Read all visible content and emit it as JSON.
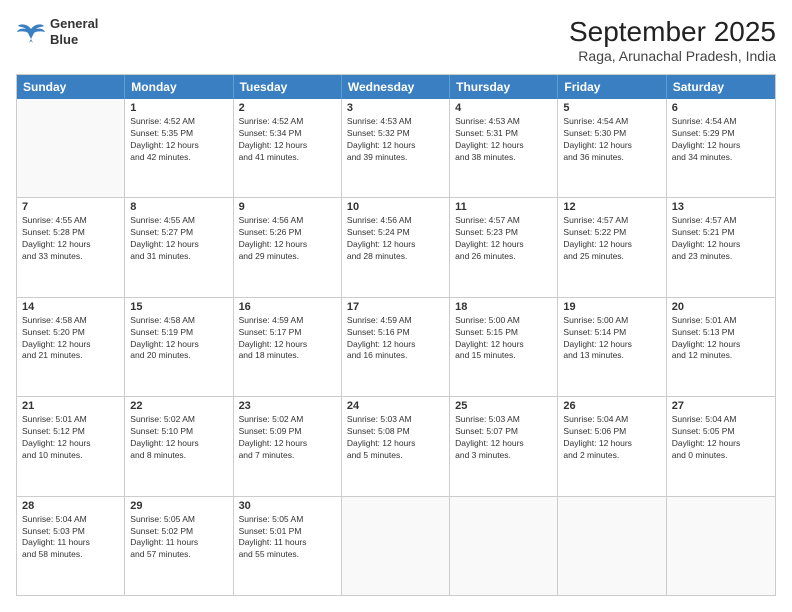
{
  "logo": {
    "line1": "General",
    "line2": "Blue"
  },
  "title": "September 2025",
  "location": "Raga, Arunachal Pradesh, India",
  "days_header": [
    "Sunday",
    "Monday",
    "Tuesday",
    "Wednesday",
    "Thursday",
    "Friday",
    "Saturday"
  ],
  "weeks": [
    [
      {
        "day": "",
        "info": ""
      },
      {
        "day": "1",
        "info": "Sunrise: 4:52 AM\nSunset: 5:35 PM\nDaylight: 12 hours\nand 42 minutes."
      },
      {
        "day": "2",
        "info": "Sunrise: 4:52 AM\nSunset: 5:34 PM\nDaylight: 12 hours\nand 41 minutes."
      },
      {
        "day": "3",
        "info": "Sunrise: 4:53 AM\nSunset: 5:32 PM\nDaylight: 12 hours\nand 39 minutes."
      },
      {
        "day": "4",
        "info": "Sunrise: 4:53 AM\nSunset: 5:31 PM\nDaylight: 12 hours\nand 38 minutes."
      },
      {
        "day": "5",
        "info": "Sunrise: 4:54 AM\nSunset: 5:30 PM\nDaylight: 12 hours\nand 36 minutes."
      },
      {
        "day": "6",
        "info": "Sunrise: 4:54 AM\nSunset: 5:29 PM\nDaylight: 12 hours\nand 34 minutes."
      }
    ],
    [
      {
        "day": "7",
        "info": "Sunrise: 4:55 AM\nSunset: 5:28 PM\nDaylight: 12 hours\nand 33 minutes."
      },
      {
        "day": "8",
        "info": "Sunrise: 4:55 AM\nSunset: 5:27 PM\nDaylight: 12 hours\nand 31 minutes."
      },
      {
        "day": "9",
        "info": "Sunrise: 4:56 AM\nSunset: 5:26 PM\nDaylight: 12 hours\nand 29 minutes."
      },
      {
        "day": "10",
        "info": "Sunrise: 4:56 AM\nSunset: 5:24 PM\nDaylight: 12 hours\nand 28 minutes."
      },
      {
        "day": "11",
        "info": "Sunrise: 4:57 AM\nSunset: 5:23 PM\nDaylight: 12 hours\nand 26 minutes."
      },
      {
        "day": "12",
        "info": "Sunrise: 4:57 AM\nSunset: 5:22 PM\nDaylight: 12 hours\nand 25 minutes."
      },
      {
        "day": "13",
        "info": "Sunrise: 4:57 AM\nSunset: 5:21 PM\nDaylight: 12 hours\nand 23 minutes."
      }
    ],
    [
      {
        "day": "14",
        "info": "Sunrise: 4:58 AM\nSunset: 5:20 PM\nDaylight: 12 hours\nand 21 minutes."
      },
      {
        "day": "15",
        "info": "Sunrise: 4:58 AM\nSunset: 5:19 PM\nDaylight: 12 hours\nand 20 minutes."
      },
      {
        "day": "16",
        "info": "Sunrise: 4:59 AM\nSunset: 5:17 PM\nDaylight: 12 hours\nand 18 minutes."
      },
      {
        "day": "17",
        "info": "Sunrise: 4:59 AM\nSunset: 5:16 PM\nDaylight: 12 hours\nand 16 minutes."
      },
      {
        "day": "18",
        "info": "Sunrise: 5:00 AM\nSunset: 5:15 PM\nDaylight: 12 hours\nand 15 minutes."
      },
      {
        "day": "19",
        "info": "Sunrise: 5:00 AM\nSunset: 5:14 PM\nDaylight: 12 hours\nand 13 minutes."
      },
      {
        "day": "20",
        "info": "Sunrise: 5:01 AM\nSunset: 5:13 PM\nDaylight: 12 hours\nand 12 minutes."
      }
    ],
    [
      {
        "day": "21",
        "info": "Sunrise: 5:01 AM\nSunset: 5:12 PM\nDaylight: 12 hours\nand 10 minutes."
      },
      {
        "day": "22",
        "info": "Sunrise: 5:02 AM\nSunset: 5:10 PM\nDaylight: 12 hours\nand 8 minutes."
      },
      {
        "day": "23",
        "info": "Sunrise: 5:02 AM\nSunset: 5:09 PM\nDaylight: 12 hours\nand 7 minutes."
      },
      {
        "day": "24",
        "info": "Sunrise: 5:03 AM\nSunset: 5:08 PM\nDaylight: 12 hours\nand 5 minutes."
      },
      {
        "day": "25",
        "info": "Sunrise: 5:03 AM\nSunset: 5:07 PM\nDaylight: 12 hours\nand 3 minutes."
      },
      {
        "day": "26",
        "info": "Sunrise: 5:04 AM\nSunset: 5:06 PM\nDaylight: 12 hours\nand 2 minutes."
      },
      {
        "day": "27",
        "info": "Sunrise: 5:04 AM\nSunset: 5:05 PM\nDaylight: 12 hours\nand 0 minutes."
      }
    ],
    [
      {
        "day": "28",
        "info": "Sunrise: 5:04 AM\nSunset: 5:03 PM\nDaylight: 11 hours\nand 58 minutes."
      },
      {
        "day": "29",
        "info": "Sunrise: 5:05 AM\nSunset: 5:02 PM\nDaylight: 11 hours\nand 57 minutes."
      },
      {
        "day": "30",
        "info": "Sunrise: 5:05 AM\nSunset: 5:01 PM\nDaylight: 11 hours\nand 55 minutes."
      },
      {
        "day": "",
        "info": ""
      },
      {
        "day": "",
        "info": ""
      },
      {
        "day": "",
        "info": ""
      },
      {
        "day": "",
        "info": ""
      }
    ]
  ]
}
